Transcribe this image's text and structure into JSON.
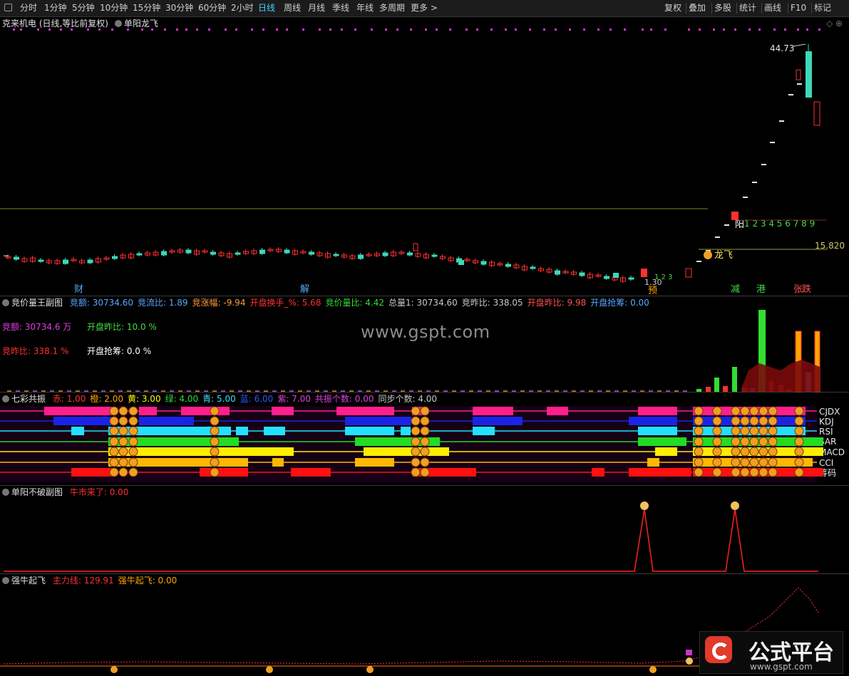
{
  "toolbar": {
    "periods": [
      "分时",
      "1分钟",
      "5分钟",
      "10分钟",
      "15分钟",
      "30分钟",
      "60分钟",
      "2小时",
      "日线",
      "周线",
      "月线",
      "季线",
      "年线",
      "多周期",
      "更多 >"
    ],
    "active": "日线",
    "right": [
      "复权",
      "叠加",
      "多股",
      "统计",
      "画线",
      "F10",
      "标记"
    ]
  },
  "main": {
    "stock_title": "克来机电 (日线,等比前复权)",
    "indicator": "单阳龙飞",
    "high_label": "44.73",
    "level_label": "15.820",
    "yang_label": "阳",
    "count_digits": "1 2 3 4 5 6 7 8 9",
    "longfei": "龙飞",
    "small_label": "1.30",
    "small_digits": "1  2  3",
    "markers": [
      "财",
      "解",
      "预",
      "减",
      "港",
      "张",
      "跌"
    ]
  },
  "panel1": {
    "name": "竞价量王副图",
    "items": [
      {
        "k": "竞额",
        "v": "30734.60",
        "color": "#5aa7ff"
      },
      {
        "k": "竞流比",
        "v": "1.89",
        "color": "#5aa7ff"
      },
      {
        "k": "竞涨幅",
        "v": "-9.94",
        "color": "#ff9a3c"
      },
      {
        "k": "开盘换手_%",
        "v": "5.68",
        "color": "#ff3030"
      },
      {
        "k": "竞价量比",
        "v": "4.42",
        "color": "#33dd33"
      },
      {
        "k": "总量1",
        "v": "30734.60",
        "color": "#c8c8c8"
      },
      {
        "k": "竞昨比",
        "v": "338.05",
        "color": "#c8c8c8"
      },
      {
        "k": "开盘昨比",
        "v": "9.98",
        "color": "#ff5050"
      },
      {
        "k": "开盘抢筹",
        "v": "0.00",
        "color": "#5aa7ff"
      }
    ],
    "line1_a": "竞额:  30734.6 万",
    "line1_b": "开盘昨比:  10.0  %",
    "line2_a": "竞昨比:  338.1  %",
    "line2_b": "开盘抢筹:  0.0  %"
  },
  "panel2": {
    "name": "七彩共振",
    "items": [
      {
        "k": "赤",
        "v": "1.00",
        "color": "#ff3030"
      },
      {
        "k": "橙",
        "v": "2.00",
        "color": "#ffa500"
      },
      {
        "k": "黄",
        "v": "3.00",
        "color": "#ffff00"
      },
      {
        "k": "绿",
        "v": "4.00",
        "color": "#33dd33"
      },
      {
        "k": "青",
        "v": "5.00",
        "color": "#33e0ff"
      },
      {
        "k": "蓝",
        "v": "6.00",
        "color": "#3355ff"
      },
      {
        "k": "紫",
        "v": "7.00",
        "color": "#e040e0"
      },
      {
        "k": "共振个数",
        "v": "0.00",
        "color": "#e040e0"
      },
      {
        "k": "同步个数",
        "v": "4.00",
        "color": "#c8c8c8"
      }
    ],
    "row_labels": [
      "CJDX",
      "KDJ",
      "RSI",
      "SAR",
      "MACD",
      "CCI",
      "筹码"
    ]
  },
  "panel3": {
    "name": "单阳不破副图",
    "items": [
      {
        "k": "牛市来了",
        "v": "0.00",
        "color": "#ff3030"
      }
    ]
  },
  "panel4": {
    "name": "强牛起飞",
    "items": [
      {
        "k": "主力线",
        "v": "129.91",
        "color": "#ff3030"
      },
      {
        "k": "强牛起飞",
        "v": "0.00",
        "color": "#ffa500"
      }
    ]
  },
  "watermark": "www.gspt.com",
  "brand": {
    "title": "公式平台",
    "url": "www.gspt.com"
  },
  "colors": {
    "up": "#ff3030",
    "down": "#3ed8b8",
    "accent": "#3fd2ff",
    "magenta": "#e040e0"
  }
}
